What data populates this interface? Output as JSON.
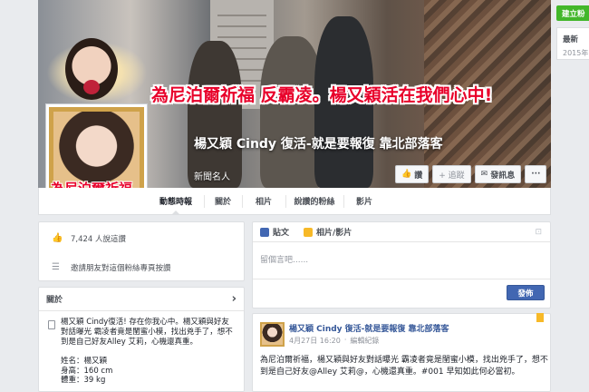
{
  "cover": {
    "banner_text": "為尼泊爾祈福 反霸凌。楊又穎活在我們心中!",
    "page_name": "楊又穎 Cindy 復活-就是要報復 靠北部落客",
    "category": "新聞名人",
    "buttons": {
      "like": "讚",
      "follow": "+ 追蹤",
      "message": "發訊息",
      "more": "···"
    }
  },
  "profile": {
    "caption": "為尼泊爾祈福"
  },
  "tabs": [
    {
      "label": "動態時報"
    },
    {
      "label": "關於"
    },
    {
      "label": "相片"
    },
    {
      "label": "說讚的粉絲"
    },
    {
      "label": "影片"
    }
  ],
  "likes_box": {
    "count_text": "7,424 人說這讚",
    "invite_text": "邀請朋友對這個粉絲專頁按讚"
  },
  "about": {
    "heading": "關於",
    "chevron": "›",
    "description": "楊又穎 Cindy復活! 存在你我心中。楊又穎與好友對話曝光 霸凌者竟是閨蜜小模，找出兇手了，想不到是自己好友Alley 艾莉，心機還真重。",
    "facts": [
      "姓名：楊又穎",
      "身高：160 cm",
      "體重：39 kg"
    ]
  },
  "composer": {
    "tab_post": "貼文",
    "tab_photo": "相片/影片",
    "placeholder": "留個言吧......",
    "post_button": "發佈"
  },
  "post": {
    "author": "楊又穎 Cindy 復活-就是要報復 靠北部落客",
    "date": "4月27日 16:20",
    "edited": "編輯紀錄",
    "text": "為尼泊爾祈福，楊又穎與好友對話曝光 霸凌者竟是閨蜜小模，找出兇手了，想不到是自己好友@Alley 艾莉@，心機還真重。#001 早知如此何必當初。"
  },
  "right_strip": {
    "build_button": "建立粉",
    "title": "最新",
    "year": "2015年"
  },
  "colors": {
    "facebook_blue": "#4267b2",
    "link_blue": "#365899",
    "banner_red": "#e8002a",
    "green_button": "#42b72a"
  }
}
